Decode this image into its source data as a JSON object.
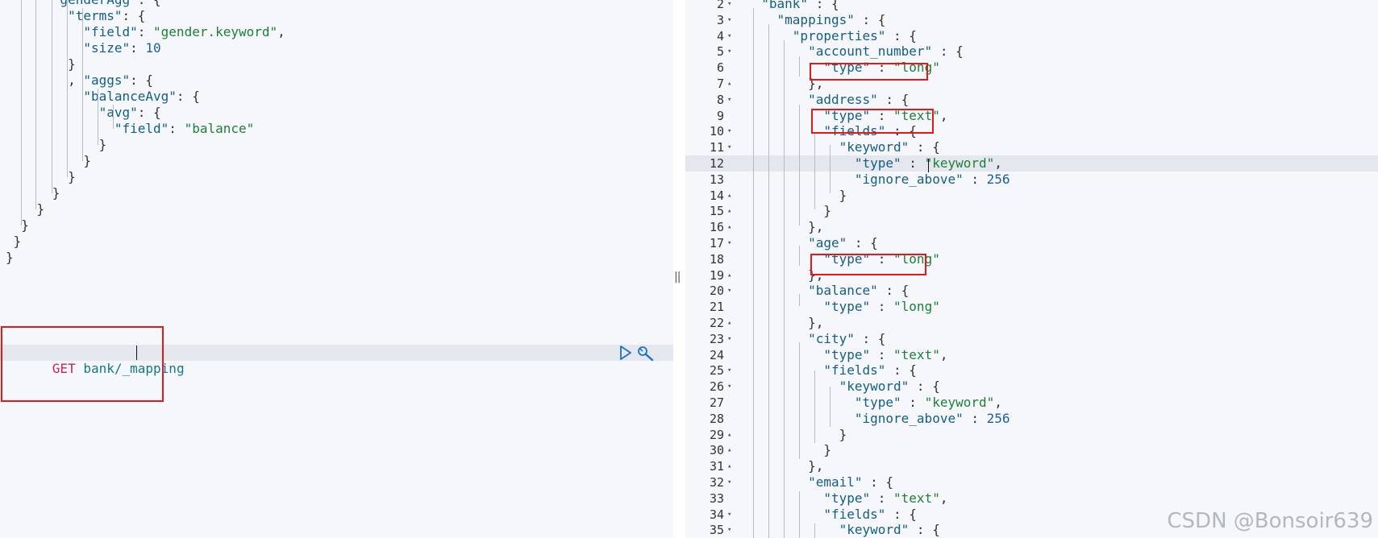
{
  "left_editor": {
    "lines": [
      [
        {
          "t": "      ",
          "c": "p"
        },
        {
          "t": "\"genderAgg\"",
          "c": "k"
        },
        {
          "t": ": {",
          "c": "p"
        }
      ],
      [
        {
          "t": "        ",
          "c": "p"
        },
        {
          "t": "\"terms\"",
          "c": "k"
        },
        {
          "t": ": {",
          "c": "p"
        }
      ],
      [
        {
          "t": "          ",
          "c": "p"
        },
        {
          "t": "\"field\"",
          "c": "k"
        },
        {
          "t": ": ",
          "c": "p"
        },
        {
          "t": "\"gender.keyword\"",
          "c": "s"
        },
        {
          "t": ",",
          "c": "p"
        }
      ],
      [
        {
          "t": "          ",
          "c": "p"
        },
        {
          "t": "\"size\"",
          "c": "k"
        },
        {
          "t": ": ",
          "c": "p"
        },
        {
          "t": "10",
          "c": "n"
        }
      ],
      [
        {
          "t": "        }",
          "c": "p"
        }
      ],
      [
        {
          "t": "        , ",
          "c": "p"
        },
        {
          "t": "\"aggs\"",
          "c": "k"
        },
        {
          "t": ": {",
          "c": "p"
        }
      ],
      [
        {
          "t": "          ",
          "c": "p"
        },
        {
          "t": "\"balanceAvg\"",
          "c": "k"
        },
        {
          "t": ": {",
          "c": "p"
        }
      ],
      [
        {
          "t": "            ",
          "c": "p"
        },
        {
          "t": "\"avg\"",
          "c": "k"
        },
        {
          "t": ": {",
          "c": "p"
        }
      ],
      [
        {
          "t": "              ",
          "c": "p"
        },
        {
          "t": "\"field\"",
          "c": "k"
        },
        {
          "t": ": ",
          "c": "p"
        },
        {
          "t": "\"balance\"",
          "c": "s"
        }
      ],
      [
        {
          "t": "            }",
          "c": "p"
        }
      ],
      [
        {
          "t": "          }",
          "c": "p"
        }
      ],
      [
        {
          "t": "        }",
          "c": "p"
        }
      ],
      [
        {
          "t": "      }",
          "c": "p"
        }
      ],
      [
        {
          "t": "    }",
          "c": "p"
        }
      ],
      [
        {
          "t": "  }",
          "c": "p"
        }
      ],
      [
        {
          "t": " }",
          "c": "p"
        }
      ],
      [
        {
          "t": "}",
          "c": "p"
        }
      ]
    ],
    "request": {
      "method": "GET",
      "path": "bank/_mapping"
    }
  },
  "right_editor": {
    "lines": [
      {
        "n": "2",
        "f": "down",
        "seg": [
          {
            "t": "  ",
            "c": "p"
          },
          {
            "t": "\"bank\"",
            "c": "k"
          },
          {
            "t": " : {",
            "c": "p"
          }
        ]
      },
      {
        "n": "3",
        "f": "down",
        "seg": [
          {
            "t": "    ",
            "c": "p"
          },
          {
            "t": "\"mappings\"",
            "c": "k"
          },
          {
            "t": " : {",
            "c": "p"
          }
        ]
      },
      {
        "n": "4",
        "f": "down",
        "seg": [
          {
            "t": "      ",
            "c": "p"
          },
          {
            "t": "\"properties\"",
            "c": "k"
          },
          {
            "t": " : {",
            "c": "p"
          }
        ]
      },
      {
        "n": "5",
        "f": "down",
        "seg": [
          {
            "t": "        ",
            "c": "p"
          },
          {
            "t": "\"account_number\"",
            "c": "k"
          },
          {
            "t": " : {",
            "c": "p"
          }
        ]
      },
      {
        "n": "6",
        "f": "",
        "seg": [
          {
            "t": "          ",
            "c": "p"
          },
          {
            "t": "\"type\"",
            "c": "k"
          },
          {
            "t": " : ",
            "c": "p"
          },
          {
            "t": "\"long\"",
            "c": "s"
          }
        ]
      },
      {
        "n": "7",
        "f": "up",
        "seg": [
          {
            "t": "        },",
            "c": "p"
          }
        ]
      },
      {
        "n": "8",
        "f": "down",
        "seg": [
          {
            "t": "        ",
            "c": "p"
          },
          {
            "t": "\"address\"",
            "c": "k"
          },
          {
            "t": " : {",
            "c": "p"
          }
        ]
      },
      {
        "n": "9",
        "f": "",
        "seg": [
          {
            "t": "          ",
            "c": "p"
          },
          {
            "t": "\"type\"",
            "c": "k"
          },
          {
            "t": " : ",
            "c": "p"
          },
          {
            "t": "\"text\"",
            "c": "s"
          },
          {
            "t": ",",
            "c": "p"
          }
        ]
      },
      {
        "n": "10",
        "f": "down",
        "seg": [
          {
            "t": "          ",
            "c": "p"
          },
          {
            "t": "\"fields\"",
            "c": "k"
          },
          {
            "t": " : {",
            "c": "p"
          }
        ]
      },
      {
        "n": "11",
        "f": "down",
        "seg": [
          {
            "t": "            ",
            "c": "p"
          },
          {
            "t": "\"keyword\"",
            "c": "k"
          },
          {
            "t": " : {",
            "c": "p"
          }
        ]
      },
      {
        "n": "12",
        "f": "",
        "seg": [
          {
            "t": "              ",
            "c": "p"
          },
          {
            "t": "\"type\"",
            "c": "k"
          },
          {
            "t": " : ",
            "c": "p"
          },
          {
            "t": "\"keyword\"",
            "c": "s"
          },
          {
            "t": ",",
            "c": "p"
          }
        ]
      },
      {
        "n": "13",
        "f": "",
        "seg": [
          {
            "t": "              ",
            "c": "p"
          },
          {
            "t": "\"ignore_above\"",
            "c": "k"
          },
          {
            "t": " : ",
            "c": "p"
          },
          {
            "t": "256",
            "c": "n"
          }
        ]
      },
      {
        "n": "14",
        "f": "up",
        "seg": [
          {
            "t": "            }",
            "c": "p"
          }
        ]
      },
      {
        "n": "15",
        "f": "up",
        "seg": [
          {
            "t": "          }",
            "c": "p"
          }
        ]
      },
      {
        "n": "16",
        "f": "up",
        "seg": [
          {
            "t": "        },",
            "c": "p"
          }
        ]
      },
      {
        "n": "17",
        "f": "down",
        "seg": [
          {
            "t": "        ",
            "c": "p"
          },
          {
            "t": "\"age\"",
            "c": "k"
          },
          {
            "t": " : {",
            "c": "p"
          }
        ]
      },
      {
        "n": "18",
        "f": "",
        "seg": [
          {
            "t": "          ",
            "c": "p"
          },
          {
            "t": "\"type\"",
            "c": "k"
          },
          {
            "t": " : ",
            "c": "p"
          },
          {
            "t": "\"long\"",
            "c": "s"
          }
        ]
      },
      {
        "n": "19",
        "f": "up",
        "seg": [
          {
            "t": "        },",
            "c": "p"
          }
        ]
      },
      {
        "n": "20",
        "f": "down",
        "seg": [
          {
            "t": "        ",
            "c": "p"
          },
          {
            "t": "\"balance\"",
            "c": "k"
          },
          {
            "t": " : {",
            "c": "p"
          }
        ]
      },
      {
        "n": "21",
        "f": "",
        "seg": [
          {
            "t": "          ",
            "c": "p"
          },
          {
            "t": "\"type\"",
            "c": "k"
          },
          {
            "t": " : ",
            "c": "p"
          },
          {
            "t": "\"long\"",
            "c": "s"
          }
        ]
      },
      {
        "n": "22",
        "f": "up",
        "seg": [
          {
            "t": "        },",
            "c": "p"
          }
        ]
      },
      {
        "n": "23",
        "f": "down",
        "seg": [
          {
            "t": "        ",
            "c": "p"
          },
          {
            "t": "\"city\"",
            "c": "k"
          },
          {
            "t": " : {",
            "c": "p"
          }
        ]
      },
      {
        "n": "24",
        "f": "",
        "seg": [
          {
            "t": "          ",
            "c": "p"
          },
          {
            "t": "\"type\"",
            "c": "k"
          },
          {
            "t": " : ",
            "c": "p"
          },
          {
            "t": "\"text\"",
            "c": "s"
          },
          {
            "t": ",",
            "c": "p"
          }
        ]
      },
      {
        "n": "25",
        "f": "down",
        "seg": [
          {
            "t": "          ",
            "c": "p"
          },
          {
            "t": "\"fields\"",
            "c": "k"
          },
          {
            "t": " : {",
            "c": "p"
          }
        ]
      },
      {
        "n": "26",
        "f": "down",
        "seg": [
          {
            "t": "            ",
            "c": "p"
          },
          {
            "t": "\"keyword\"",
            "c": "k"
          },
          {
            "t": " : {",
            "c": "p"
          }
        ]
      },
      {
        "n": "27",
        "f": "",
        "seg": [
          {
            "t": "              ",
            "c": "p"
          },
          {
            "t": "\"type\"",
            "c": "k"
          },
          {
            "t": " : ",
            "c": "p"
          },
          {
            "t": "\"keyword\"",
            "c": "s"
          },
          {
            "t": ",",
            "c": "p"
          }
        ]
      },
      {
        "n": "28",
        "f": "",
        "seg": [
          {
            "t": "              ",
            "c": "p"
          },
          {
            "t": "\"ignore_above\"",
            "c": "k"
          },
          {
            "t": " : ",
            "c": "p"
          },
          {
            "t": "256",
            "c": "n"
          }
        ]
      },
      {
        "n": "29",
        "f": "up",
        "seg": [
          {
            "t": "            }",
            "c": "p"
          }
        ]
      },
      {
        "n": "30",
        "f": "up",
        "seg": [
          {
            "t": "          }",
            "c": "p"
          }
        ]
      },
      {
        "n": "31",
        "f": "up",
        "seg": [
          {
            "t": "        },",
            "c": "p"
          }
        ]
      },
      {
        "n": "32",
        "f": "down",
        "seg": [
          {
            "t": "        ",
            "c": "p"
          },
          {
            "t": "\"email\"",
            "c": "k"
          },
          {
            "t": " : {",
            "c": "p"
          }
        ]
      },
      {
        "n": "33",
        "f": "",
        "seg": [
          {
            "t": "          ",
            "c": "p"
          },
          {
            "t": "\"type\"",
            "c": "k"
          },
          {
            "t": " : ",
            "c": "p"
          },
          {
            "t": "\"text\"",
            "c": "s"
          },
          {
            "t": ",",
            "c": "p"
          }
        ]
      },
      {
        "n": "34",
        "f": "down",
        "seg": [
          {
            "t": "          ",
            "c": "p"
          },
          {
            "t": "\"fields\"",
            "c": "k"
          },
          {
            "t": " : {",
            "c": "p"
          }
        ]
      },
      {
        "n": "35",
        "f": "down",
        "seg": [
          {
            "t": "            ",
            "c": "p"
          },
          {
            "t": "\"keyword\"",
            "c": "k"
          },
          {
            "t": " : {",
            "c": "p"
          }
        ]
      }
    ]
  },
  "watermark": "CSDN @Bonsoir639",
  "colors": {
    "highlight_box": "#e01a1a",
    "key": "#135e85",
    "string": "#1c7f3a",
    "number": "#1a5fa6",
    "method": "#c6245c",
    "path": "#117a86"
  },
  "icons": {
    "run": "play-icon",
    "settings": "wrench-icon"
  }
}
